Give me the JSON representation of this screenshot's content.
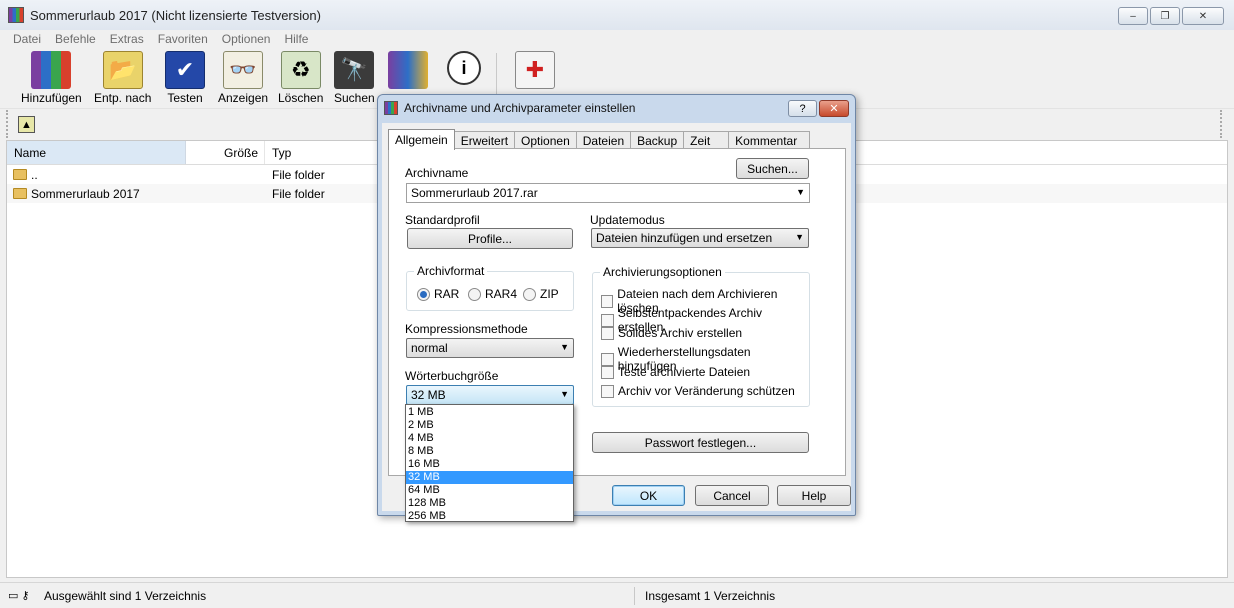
{
  "window": {
    "title": "Sommerurlaub 2017 (Nicht lizensierte Testversion)",
    "controls": [
      "‒",
      "❐",
      "✕"
    ]
  },
  "menu": [
    "Datei",
    "Befehle",
    "Extras",
    "Favoriten",
    "Optionen",
    "Hilfe"
  ],
  "toolbar": {
    "buttons": [
      {
        "label": "Hinzufügen",
        "icon": "add-archive-icon"
      },
      {
        "label": "Entp. nach",
        "icon": "extract-to-icon"
      },
      {
        "label": "Testen",
        "icon": "test-icon"
      },
      {
        "label": "Anzeigen",
        "icon": "view-icon"
      },
      {
        "label": "Löschen",
        "icon": "delete-icon"
      },
      {
        "label": "Suchen",
        "icon": "find-icon"
      },
      {
        "label": "",
        "icon": "wizard-icon"
      },
      {
        "label": "",
        "icon": "info-icon"
      },
      {
        "label": "",
        "icon": "repair-icon"
      }
    ]
  },
  "filelist": {
    "columns": {
      "name": "Name",
      "size": "Größe",
      "type": "Typ"
    },
    "rows": [
      {
        "name": "..",
        "type": "File folder"
      },
      {
        "name": "Sommerurlaub 2017",
        "type": "File folder"
      }
    ]
  },
  "status": {
    "left": "Ausgewählt sind 1 Verzeichnis",
    "right": "Insgesamt 1 Verzeichnis"
  },
  "dialog": {
    "title": "Archivname und Archivparameter einstellen",
    "help": "?",
    "close": "✕",
    "tabs": [
      "Allgemein",
      "Erweitert",
      "Optionen",
      "Dateien",
      "Backup",
      "Zeit",
      "Kommentar"
    ],
    "archivname_label": "Archivname",
    "browse_button": "Suchen...",
    "archivname_value": "Sommerurlaub 2017.rar",
    "standardprofil_label": "Standardprofil",
    "profile_button": "Profile...",
    "updatemodus_label": "Updatemodus",
    "updatemodus_value": "Dateien hinzufügen und ersetzen",
    "archivformat_label": "Archivformat",
    "formats": [
      "RAR",
      "RAR4",
      "ZIP"
    ],
    "selected_format": "RAR",
    "kompression_label": "Kompressionsmethode",
    "kompression_value": "normal",
    "woerterbuch_label": "Wörterbuchgröße",
    "woerterbuch_value": "32 MB",
    "woerterbuch_options": [
      "1 MB",
      "2 MB",
      "4 MB",
      "8 MB",
      "16 MB",
      "32 MB",
      "64 MB",
      "128 MB",
      "256 MB"
    ],
    "archivierungsoptionen_label": "Archivierungsoptionen",
    "options": [
      "Dateien nach dem Archivieren löschen",
      "Selbstentpackendes Archiv erstellen",
      "Solides Archiv erstellen",
      "Wiederherstellungsdaten hinzufügen",
      "Teste archivierte Dateien",
      "Archiv vor Veränderung schützen"
    ],
    "password_button": "Passwort festlegen...",
    "ok_button": "OK",
    "cancel_button": "Cancel",
    "help_button": "Help"
  }
}
